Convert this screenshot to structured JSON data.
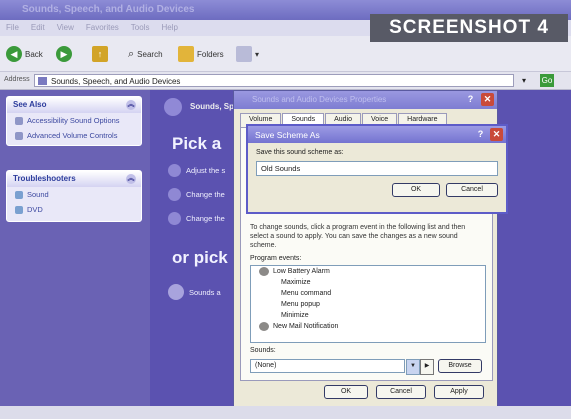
{
  "window": {
    "title": "Sounds, Speech, and Audio Devices"
  },
  "menu": [
    "File",
    "Edit",
    "View",
    "Favorites",
    "Tools",
    "Help"
  ],
  "toolbar": {
    "back_label": "Back",
    "search_label": "Search",
    "folders_label": "Folders"
  },
  "address": {
    "label": "Address",
    "value": "Sounds, Speech, and Audio Devices",
    "go_label": "Go"
  },
  "badge": "SCREENSHOT 4",
  "see_also": {
    "title": "See Also",
    "items": [
      "Accessibility Sound Options",
      "Advanced Volume Controls"
    ]
  },
  "troubleshooters": {
    "title": "Troubleshooters",
    "items": [
      "Sound",
      "DVD"
    ]
  },
  "main": {
    "header": "Sounds, Sp",
    "pick_task": "Pick a",
    "tasks": [
      "Adjust the s",
      "Change the",
      "Change the"
    ],
    "or_pick": "or pick",
    "cp_icon_label": "Sounds a"
  },
  "props": {
    "title": "Sounds and Audio Devices Properties",
    "tabs": [
      "Volume",
      "Sounds",
      "Audio",
      "Voice",
      "Hardware"
    ],
    "active_tab": 1,
    "instructions": "To change sounds, click a program event in the following list and then select a sound to apply. You can save the changes as a new sound scheme.",
    "events_label": "Program events:",
    "events": [
      {
        "name": "Low Battery Alarm",
        "has_sound": true
      },
      {
        "name": "Maximize",
        "has_sound": false
      },
      {
        "name": "Menu command",
        "has_sound": false
      },
      {
        "name": "Menu popup",
        "has_sound": false
      },
      {
        "name": "Minimize",
        "has_sound": false
      },
      {
        "name": "New Mail Notification",
        "has_sound": true
      }
    ],
    "sounds_label": "Sounds:",
    "sounds_value": "(None)",
    "browse_label": "Browse",
    "ok_label": "OK",
    "cancel_label": "Cancel",
    "apply_label": "Apply"
  },
  "save_dialog": {
    "title": "Save Scheme As",
    "prompt": "Save this sound scheme as:",
    "value": "Old Sounds",
    "ok_label": "OK",
    "cancel_label": "Cancel"
  }
}
